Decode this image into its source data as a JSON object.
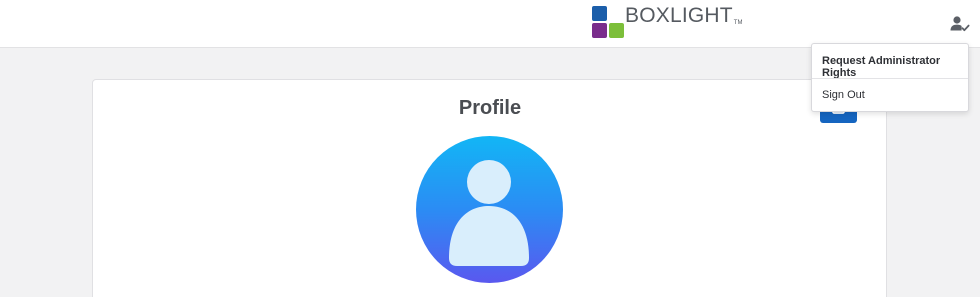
{
  "header": {
    "logo": {
      "text": "BOXLIGHT",
      "tm": "TM",
      "square_colors": [
        "#1b5eaa",
        "#ffffff",
        "#7a2d8c",
        "#7cbf3a"
      ]
    },
    "user_icon": "user-admin-icon"
  },
  "profile": {
    "title": "Profile",
    "edit_icon": "edit-icon",
    "avatar_icon": "person-avatar-icon"
  },
  "user_menu": {
    "items": [
      {
        "label": "Request Administrator Rights"
      },
      {
        "label": "Sign Out"
      }
    ]
  },
  "colors": {
    "accent": "#1565c0",
    "avatar_top": "#12b6f5",
    "avatar_bottom": "#5a58ef",
    "page_bg": "#f2f2f3"
  }
}
